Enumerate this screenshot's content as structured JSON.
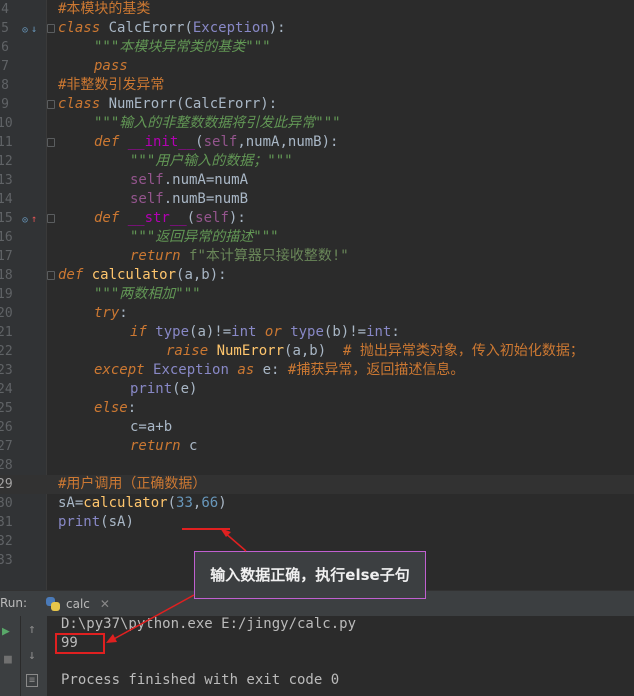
{
  "editor": {
    "lines": [
      {
        "n": "4",
        "indent": 0,
        "tokens": [
          [
            "cmt",
            "#本模块的基类"
          ]
        ]
      },
      {
        "n": "5",
        "indent": 0,
        "tokens": [
          [
            "kw",
            "class "
          ],
          [
            "cls",
            "CalcErorr"
          ],
          [
            "txt",
            "("
          ],
          [
            "exc",
            "Exception"
          ],
          [
            "txt",
            "):"
          ]
        ]
      },
      {
        "n": "6",
        "indent": 1,
        "tokens": [
          [
            "str",
            "\"\"\"本模块异常类的基类\"\"\""
          ]
        ]
      },
      {
        "n": "7",
        "indent": 1,
        "tokens": [
          [
            "kw",
            "pass"
          ]
        ]
      },
      {
        "n": "8",
        "indent": 0,
        "tokens": [
          [
            "cmt",
            "#非整数引发异常"
          ]
        ]
      },
      {
        "n": "9",
        "indent": 0,
        "tokens": [
          [
            "kw",
            "class "
          ],
          [
            "cls",
            "NumErorr"
          ],
          [
            "txt",
            "(CalcErorr):"
          ]
        ]
      },
      {
        "n": "10",
        "indent": 1,
        "tokens": [
          [
            "str",
            "\"\"\"输入的非整数数据将引发此异常\"\"\""
          ]
        ]
      },
      {
        "n": "11",
        "indent": 1,
        "tokens": [
          [
            "kw",
            "def "
          ],
          [
            "dunder",
            "__init__"
          ],
          [
            "txt",
            "("
          ],
          [
            "selfk",
            "self"
          ],
          [
            "txt",
            ",numA,numB):"
          ]
        ]
      },
      {
        "n": "12",
        "indent": 2,
        "tokens": [
          [
            "str",
            "\"\"\"用户输入的数据；\"\"\""
          ]
        ]
      },
      {
        "n": "13",
        "indent": 2,
        "tokens": [
          [
            "selfk",
            "self"
          ],
          [
            "txt",
            ".numA=numA"
          ]
        ]
      },
      {
        "n": "14",
        "indent": 2,
        "tokens": [
          [
            "selfk",
            "self"
          ],
          [
            "txt",
            ".numB=numB"
          ]
        ]
      },
      {
        "n": "15",
        "indent": 1,
        "tokens": [
          [
            "kw",
            "def "
          ],
          [
            "dunder",
            "__str__"
          ],
          [
            "txt",
            "("
          ],
          [
            "selfk",
            "self"
          ],
          [
            "txt",
            "):"
          ]
        ]
      },
      {
        "n": "16",
        "indent": 2,
        "tokens": [
          [
            "str",
            "\"\"\"返回异常的描述\"\"\""
          ]
        ]
      },
      {
        "n": "17",
        "indent": 2,
        "tokens": [
          [
            "kw",
            "return "
          ],
          [
            "strn",
            "f\"本计算器只接收整数!\""
          ]
        ]
      },
      {
        "n": "18",
        "indent": 0,
        "tokens": [
          [
            "kw",
            "def "
          ],
          [
            "fn",
            "calculator"
          ],
          [
            "txt",
            "(a,b):"
          ]
        ]
      },
      {
        "n": "19",
        "indent": 1,
        "tokens": [
          [
            "str",
            "\"\"\"两数相加\"\"\""
          ]
        ]
      },
      {
        "n": "20",
        "indent": 1,
        "tokens": [
          [
            "kw",
            "try"
          ],
          [
            "txt",
            ":"
          ]
        ]
      },
      {
        "n": "21",
        "indent": 2,
        "tokens": [
          [
            "kw",
            "if "
          ],
          [
            "bi",
            "type"
          ],
          [
            "txt",
            "(a)!="
          ],
          [
            "bi",
            "int "
          ],
          [
            "kw",
            "or "
          ],
          [
            "bi",
            "type"
          ],
          [
            "txt",
            "(b)!="
          ],
          [
            "bi",
            "int"
          ],
          [
            "txt",
            ":"
          ]
        ]
      },
      {
        "n": "22",
        "indent": 3,
        "tokens": [
          [
            "kw",
            "raise "
          ],
          [
            "fn",
            "NumErorr"
          ],
          [
            "txt",
            "(a,b)  "
          ],
          [
            "amb",
            "# 抛出异常类对象，传入初始化数据；"
          ]
        ]
      },
      {
        "n": "23",
        "indent": 1,
        "tokens": [
          [
            "kw",
            "except "
          ],
          [
            "exc",
            "Exception "
          ],
          [
            "kw",
            "as "
          ],
          [
            "txt",
            "e: "
          ],
          [
            "amb",
            "#捕获异常，返回描述信息。"
          ]
        ]
      },
      {
        "n": "24",
        "indent": 2,
        "tokens": [
          [
            "bi",
            "print"
          ],
          [
            "txt",
            "(e)"
          ]
        ]
      },
      {
        "n": "25",
        "indent": 1,
        "tokens": [
          [
            "kw",
            "else"
          ],
          [
            "txt",
            ":"
          ]
        ]
      },
      {
        "n": "26",
        "indent": 2,
        "tokens": [
          [
            "txt",
            "c=a+b"
          ]
        ]
      },
      {
        "n": "27",
        "indent": 2,
        "tokens": [
          [
            "kw",
            "return "
          ],
          [
            "txt",
            "c"
          ]
        ]
      },
      {
        "n": "28",
        "indent": 0,
        "tokens": []
      },
      {
        "n": "29",
        "indent": 0,
        "tokens": [
          [
            "cmt",
            "#用户调用（正确数据）"
          ]
        ],
        "current": true
      },
      {
        "n": "30",
        "indent": 0,
        "tokens": [
          [
            "txt",
            "sA="
          ],
          [
            "fn",
            "calculator"
          ],
          [
            "txt",
            "("
          ],
          [
            "numv",
            "33"
          ],
          [
            "txt",
            ","
          ],
          [
            "numv",
            "66"
          ],
          [
            "txt",
            ")"
          ]
        ]
      },
      {
        "n": "31",
        "indent": 0,
        "tokens": [
          [
            "bi",
            "print"
          ],
          [
            "txt",
            "(sA)"
          ]
        ]
      },
      {
        "n": "32",
        "indent": 0,
        "tokens": []
      },
      {
        "n": "33",
        "indent": 0,
        "tokens": []
      }
    ]
  },
  "annotation": {
    "callout_text": "输入数据正确，执行else子句",
    "accent_color": "#e02020",
    "callout_border": "#c060d0"
  },
  "run_panel": {
    "label": "Run:",
    "tab_label": "calc",
    "tab_icon": "python-icon",
    "command": "D:\\py37\\python.exe E:/jingy/calc.py",
    "output": "99",
    "exit_message": "Process finished with exit code 0"
  },
  "colors": {
    "background": "#2b2b2b",
    "keyword": "#cc7832",
    "docstring": "#629755",
    "function": "#ffc66d",
    "number": "#6897bb"
  }
}
